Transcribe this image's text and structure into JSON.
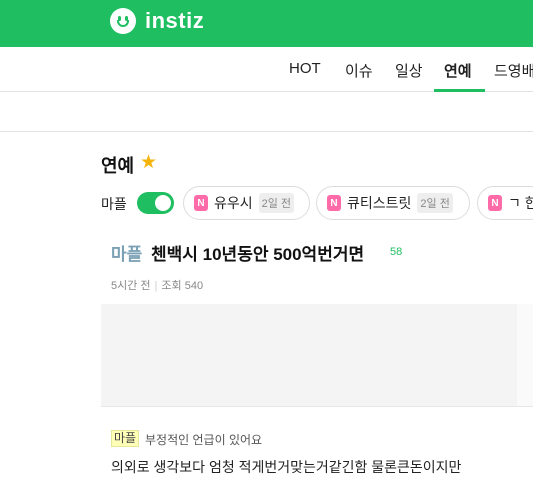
{
  "brand": {
    "name": "instiz",
    "logo_icon": "smiley-logo-icon",
    "color": "#1fbf61"
  },
  "nav": {
    "tabs": [
      {
        "label": "HOT"
      },
      {
        "label": "이슈"
      },
      {
        "label": "일상"
      },
      {
        "label": "연예",
        "active": true
      },
      {
        "label": "드영배"
      }
    ]
  },
  "section": {
    "title": "연예",
    "favorite_icon": "star-icon",
    "star_color": "#f5b40a"
  },
  "filter": {
    "toggle_label": "마플",
    "toggle_on": true
  },
  "chips": [
    {
      "badge": "N",
      "name": "유우시",
      "time": "2일 전"
    },
    {
      "badge": "N",
      "name": "큐티스트릿",
      "time": "2일 전"
    },
    {
      "badge": "N",
      "name": "ㄱ 한",
      "time": ""
    }
  ],
  "post": {
    "category": "마플",
    "title": "첸백시 10년동안 500억번거면",
    "comment_count": "58",
    "time": "5시간 전",
    "views": "조회 540"
  },
  "comment": {
    "tag": "마플",
    "note": "부정적인 언급이 있어요",
    "text": "의외로 생각보다 엄청 적게번거맞는거같긴함 물론큰돈이지만"
  }
}
